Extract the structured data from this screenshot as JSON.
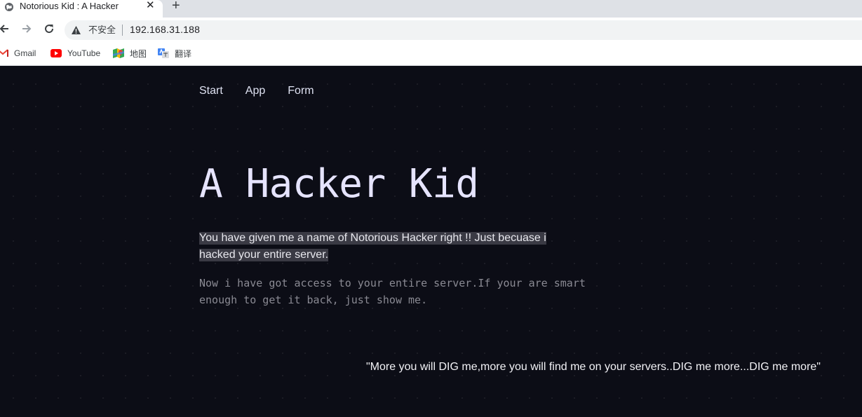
{
  "browser": {
    "tab": {
      "title": "Notorious Kid : A Hacker",
      "close": "✕"
    },
    "new_tab": "+",
    "address": {
      "security_label": "不安全",
      "url": "192.168.31.188"
    },
    "bookmarks": [
      {
        "label": "Gmail",
        "icon": "gmail-icon"
      },
      {
        "label": "YouTube",
        "icon": "youtube-icon"
      },
      {
        "label": "地图",
        "icon": "maps-icon"
      },
      {
        "label": "翻译",
        "icon": "translate-icon"
      }
    ]
  },
  "page": {
    "menu": [
      "Start",
      "App",
      "Form"
    ],
    "hero_title": "A Hacker Kid",
    "lead": "You have given me a name of Notorious Hacker right !! Just becuase i hacked your entire server.",
    "sub": "Now i have got access to your entire server.If your are smart enough to get it back, just show me.",
    "quote": "\"More you will DIG me,more you will find me on your servers..DIG me more...DIG me more\""
  },
  "colors": {
    "page_background": "#0c0d16",
    "hero_text": "#e6e4ff",
    "lead_highlight": "#3a3a44",
    "sub_text": "#8a8a93"
  }
}
